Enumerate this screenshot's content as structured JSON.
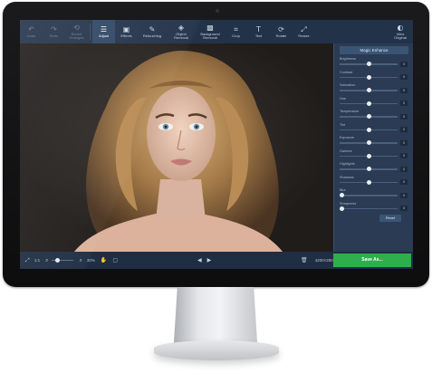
{
  "toolbar": {
    "items": [
      {
        "label": "Undo",
        "icon": "undo-icon",
        "glyph": "↶"
      },
      {
        "label": "Redo",
        "icon": "redo-icon",
        "glyph": "↷"
      },
      {
        "label": "Revert\nChanges",
        "icon": "revert-icon",
        "glyph": "⟲"
      },
      {
        "label": "Adjust",
        "icon": "adjust-icon",
        "glyph": "☰"
      },
      {
        "label": "Effects",
        "icon": "effects-icon",
        "glyph": "▣"
      },
      {
        "label": "Retouching",
        "icon": "retouching-icon",
        "glyph": "✎"
      },
      {
        "label": "Object\nRemoval",
        "icon": "object-removal-icon",
        "glyph": "◈"
      },
      {
        "label": "Background\nRemoval",
        "icon": "background-removal-icon",
        "glyph": "▩"
      },
      {
        "label": "Crop",
        "icon": "crop-icon",
        "glyph": "⌗"
      },
      {
        "label": "Text",
        "icon": "text-icon",
        "glyph": "T"
      },
      {
        "label": "Rotate",
        "icon": "rotate-icon",
        "glyph": "⟳"
      },
      {
        "label": "Resize",
        "icon": "resize-icon",
        "glyph": "⤢"
      }
    ],
    "view_original": "View\nOriginal",
    "view_original_glyph": "◐"
  },
  "panel": {
    "magic_enhance": "Magic Enhance",
    "sliders": [
      {
        "name": "Brightness",
        "value": "0",
        "pos": 0.5
      },
      {
        "name": "Contrast",
        "value": "0",
        "pos": 0.5
      },
      {
        "name": "Saturation",
        "value": "0",
        "pos": 0.5
      },
      {
        "name": "Hue",
        "value": "0",
        "pos": 0.5
      },
      {
        "name": "Temperature",
        "value": "0",
        "pos": 0.5
      },
      {
        "name": "Tint",
        "value": "0",
        "pos": 0.5
      },
      {
        "name": "Exposure",
        "value": "0",
        "pos": 0.5
      },
      {
        "name": "Gamma",
        "value": "0",
        "pos": 0.5
      },
      {
        "name": "Highlights",
        "value": "0",
        "pos": 0.5
      },
      {
        "name": "Shadows",
        "value": "0",
        "pos": 0.5
      },
      {
        "name": "Blur",
        "value": "0",
        "pos": 0.0
      },
      {
        "name": "Sharpness",
        "value": "0",
        "pos": 0.0
      }
    ],
    "reset": "Reset"
  },
  "bottombar": {
    "fit_label": "1:1",
    "zoom_value": "30%",
    "image_size": "4200×2800",
    "save_label": "Save As..."
  },
  "colors": {
    "accent": "#2fae4e",
    "toolbar_bg": "#223249",
    "panel_bg": "#2a3b53"
  }
}
